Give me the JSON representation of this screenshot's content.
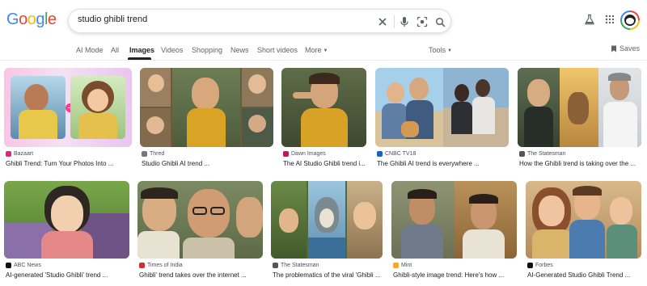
{
  "search": {
    "query": "studio ghibli trend"
  },
  "tabs": [
    {
      "label": "AI Mode"
    },
    {
      "label": "All"
    },
    {
      "label": "Images"
    },
    {
      "label": "Videos"
    },
    {
      "label": "Shopping"
    },
    {
      "label": "News"
    },
    {
      "label": "Short videos"
    },
    {
      "label": "More"
    },
    {
      "label": "Tools"
    }
  ],
  "saves_label": "Saves",
  "colors": {
    "brand_blue": "#4285f4",
    "brand_red": "#ea4335",
    "brand_yellow": "#fbbc05",
    "brand_green": "#34a853"
  },
  "results": [
    {
      "source": "Bazaart",
      "title": "Ghibli Trend: Turn Your Photos Into ..."
    },
    {
      "source": "Thred",
      "title": "Studio Ghibli AI trend ..."
    },
    {
      "source": "Dawn Images",
      "title": "The AI Studio Ghibli trend i..."
    },
    {
      "source": "CNBC TV18",
      "title": "The Ghibli AI trend is everywhere ..."
    },
    {
      "source": "The Statesman",
      "title": "How the Ghibli trend is taking over the ..."
    },
    {
      "source": "ABC News",
      "title": "AI-generated 'Studio Ghibli' trend ..."
    },
    {
      "source": "Times of India",
      "title": "Ghibli' trend takes over the internet ..."
    },
    {
      "source": "The Statesman",
      "title": "The problematics of the viral 'Ghibli ..."
    },
    {
      "source": "Mint",
      "title": "Ghibli-style image trend: Here's how ..."
    },
    {
      "source": "Forbes",
      "title": "AI-Generated Studio Ghibli Trend ..."
    }
  ]
}
